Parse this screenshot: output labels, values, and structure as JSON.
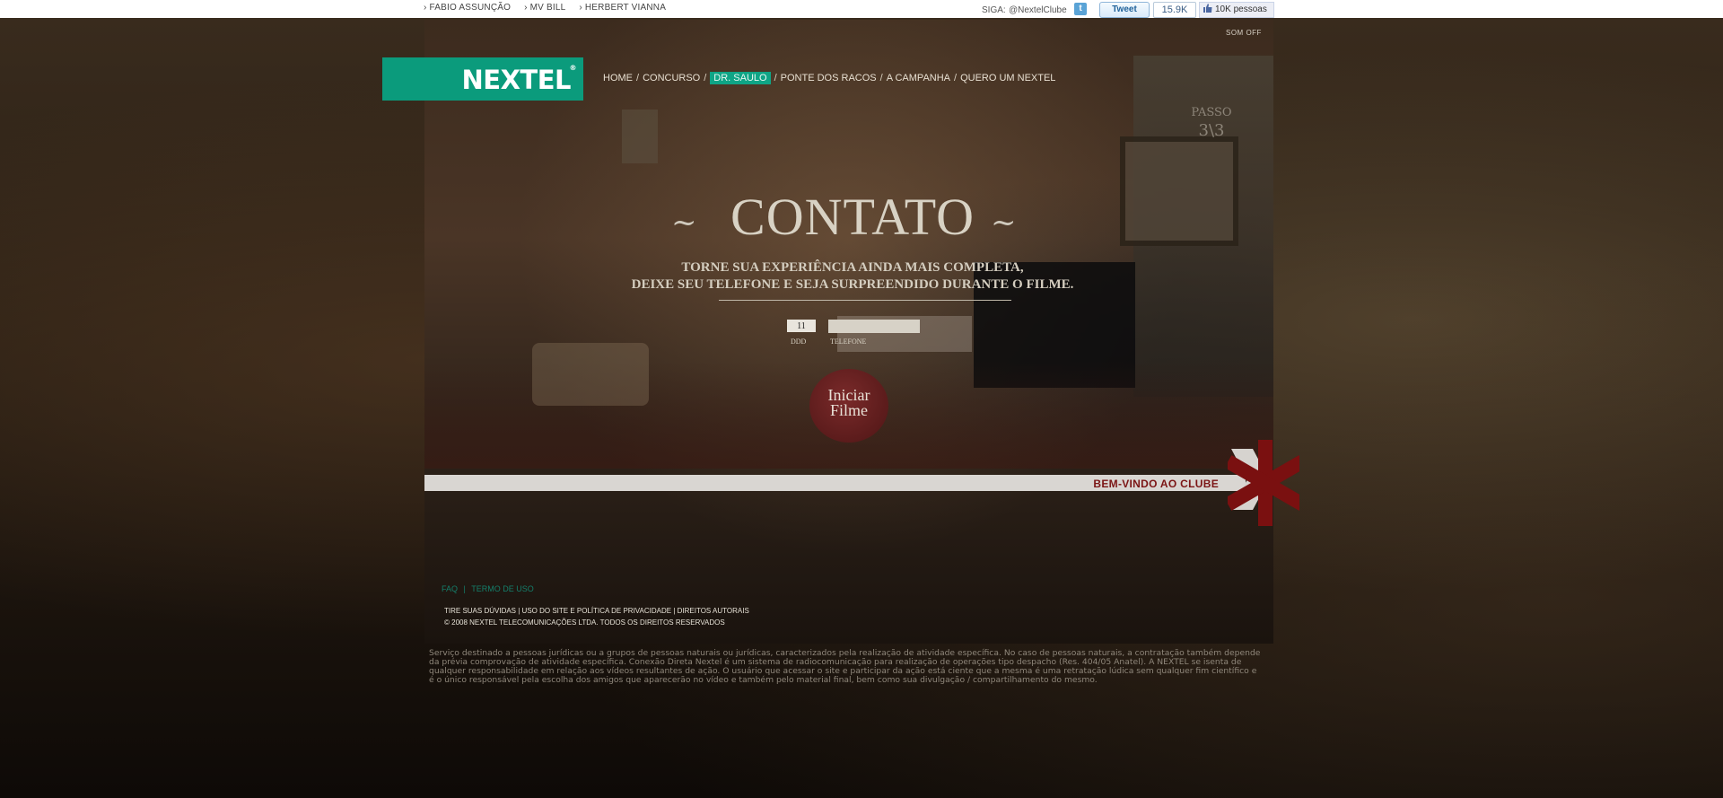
{
  "topbar": {
    "links": [
      "› FABIO ASSUNÇÃO",
      "› MV BILL",
      "› HERBERT VIANNA"
    ],
    "siga_label": "SIGA:",
    "twitter_handle": "@NextelClube",
    "tweet_label": "Tweet",
    "tweet_count": "15.9K",
    "like_label": "10K pessoas"
  },
  "header": {
    "logo_text": "NEXTEL",
    "logo_reg": "®",
    "som_off": "SOM OFF",
    "nav": [
      {
        "label": "HOME"
      },
      {
        "label": "CONCURSO"
      },
      {
        "label": "DR. SAULO",
        "active": true
      },
      {
        "label": "PONTE DOS RACOS"
      },
      {
        "label": "A CAMPANHA"
      },
      {
        "label": "QUERO UM NEXTEL"
      }
    ]
  },
  "step": {
    "label": "PASSO",
    "value": "3\\3"
  },
  "contact": {
    "title": "CONTATO",
    "subtitle_line1": "TORNE SUA EXPERIÊNCIA AINDA MAIS COMPLETA,",
    "subtitle_line2": "DEIXE SEU TELEFONE E SEJA SURPREENDIDO DURANTE O FILME.",
    "ddd_value": "11",
    "ddd_label": "DDD",
    "phone_value": "",
    "phone_label": "TELEFONE",
    "start_line1": "Iniciar",
    "start_line2": "Filme"
  },
  "welcome": {
    "text": "BEM-VINDO AO CLUBE"
  },
  "footer": {
    "faq": "FAQ",
    "divider": "|",
    "terms": "TERMO DE USO",
    "legal_links": "TIRE SUAS DÚVIDAS  |  USO DO SITE E POLÍTICA DE PRIVACIDADE  |  DIREITOS AUTORAIS",
    "copyright": "© 2008 NEXTEL TELECOMUNICAÇÕES LTDA. TODOS OS DIREITOS RESERVADOS",
    "disclaimer": "Serviço destinado a pessoas jurídicas ou a grupos de pessoas naturais ou jurídicas, caracterizados pela realização de atividade específica. No caso de pessoas naturais, a contratação também depende da prévia comprovação de atividade específica. Conexão Direta Nextel é um sistema de radiocomunicação para realização de operações tipo despacho (Res. 404/05 Anatel). A NEXTEL se isenta de qualquer responsabilidade em relação aos vídeos resultantes de ação. O usuário que acessar o site e participar da ação está ciente que a mesma é uma retratação lúdica sem qualquer fim científico e é o único responsável pela escolha dos amigos que aparecerão no vídeo e também pelo material final, bem como sua divulgação / compartilhamento do mesmo."
  },
  "colors": {
    "brand_green": "#0b9b7c",
    "accent_red": "#7b1515",
    "nav_active": "#0fa586"
  }
}
